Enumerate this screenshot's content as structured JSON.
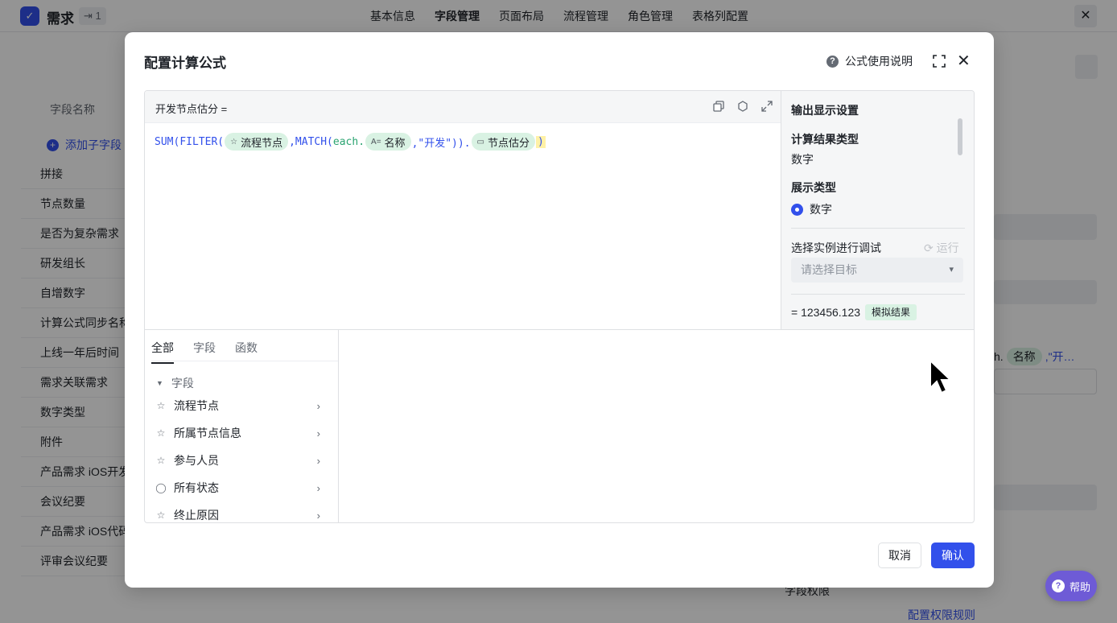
{
  "app": {
    "title": "需求",
    "badge": "⇥ 1",
    "nav": [
      "基本信息",
      "字段管理",
      "页面布局",
      "流程管理",
      "角色管理",
      "表格列配置"
    ],
    "active_nav": "字段管理",
    "close": "✕"
  },
  "field_panel": {
    "header": "字段名称",
    "add_sub_label": "添加子字段",
    "fields": [
      "拼接",
      "节点数量",
      "是否为复杂需求",
      "研发组长",
      "自增数字",
      "计算公式同步名称",
      "上线一年后时间",
      "需求关联需求",
      "数字类型",
      "附件",
      "产品需求 iOS开发",
      "会议纪要",
      "产品需求 iOS代码",
      "评审会议纪要"
    ]
  },
  "right_fragments": {
    "chip_name": "名称",
    "snippet_prefix": "h.",
    "snippet_suffix": ",\"开…",
    "permission_label": "字段权限",
    "permission_link": "配置权限规则"
  },
  "modal": {
    "title": "配置计算公式",
    "help_label": "公式使用说明",
    "help_icon": "?",
    "close_icon": "✕",
    "editor": {
      "field_label": "开发节点估分 =",
      "formula": {
        "fn_open": "SUM(",
        "filter_open": "FILTER(",
        "chip1": "流程节点",
        "match_open": ",MATCH(",
        "each": "each.",
        "chip2": "名称",
        "arg": ",\"开发\")).",
        "chip3": "节点估分",
        "close": ")"
      }
    },
    "output": {
      "title": "输出显示设置",
      "result_type_label": "计算结果类型",
      "result_type_value": "数字",
      "display_type_label": "展示类型",
      "display_option": "数字",
      "debug_label": "选择实例进行调试",
      "run_label": "⟳ 运行",
      "select_placeholder": "请选择目标",
      "result_value": "= 123456.123",
      "result_tag": "模拟结果"
    },
    "browser": {
      "tabs": [
        "全部",
        "字段",
        "函数"
      ],
      "active_tab": "全部",
      "group": "字段",
      "items": [
        {
          "label": "流程节点",
          "icon": "flow-node-icon"
        },
        {
          "label": "所属节点信息",
          "icon": "flow-node-icon"
        },
        {
          "label": "参与人员",
          "icon": "flow-node-icon"
        },
        {
          "label": "所有状态",
          "icon": "status-icon"
        },
        {
          "label": "终止原因",
          "icon": "flow-node-icon"
        }
      ]
    },
    "buttons": {
      "cancel": "取消",
      "ok": "确认"
    }
  },
  "help_fab": {
    "label": "帮助"
  },
  "colors": {
    "primary": "#3250eb",
    "chip_bg": "#d9f2e3",
    "help_fab": "#6e5bd6",
    "highlight": "#fff1a6"
  }
}
